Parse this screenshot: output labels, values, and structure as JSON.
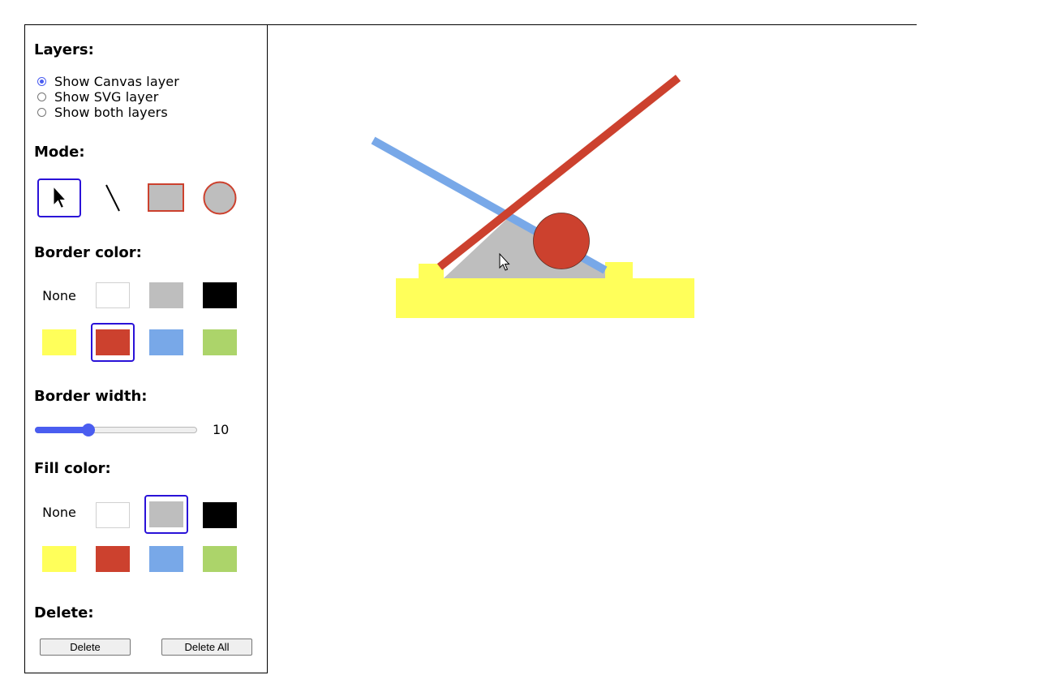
{
  "layers": {
    "heading": "Layers:",
    "options": [
      {
        "label": "Show Canvas layer",
        "checked": true
      },
      {
        "label": "Show SVG layer",
        "checked": false
      },
      {
        "label": "Show both layers",
        "checked": false
      }
    ]
  },
  "mode": {
    "heading": "Mode:",
    "tools": [
      {
        "name": "select-tool",
        "icon": "arrow-pointer-icon",
        "selected": true
      },
      {
        "name": "line-tool",
        "icon": "line-icon",
        "selected": false
      },
      {
        "name": "rectangle-tool",
        "icon": "rectangle-icon",
        "selected": false
      },
      {
        "name": "circle-tool",
        "icon": "circle-icon",
        "selected": false
      }
    ]
  },
  "border_color": {
    "heading": "Border color:",
    "none_label": "None",
    "swatches": [
      "#ffffff",
      "#bebebe",
      "#000000",
      "#ffff5a",
      "#cc412e",
      "#78a8e8",
      "#acd46a"
    ],
    "selected": "#cc412e"
  },
  "border_width": {
    "heading": "Border width:",
    "value": "10",
    "fraction": 0.33
  },
  "fill_color": {
    "heading": "Fill color:",
    "none_label": "None",
    "swatches": [
      "#ffffff",
      "#bebebe",
      "#000000",
      "#ffff5a",
      "#cc412e",
      "#78a8e8",
      "#acd46a"
    ],
    "selected": "#bebebe"
  },
  "delete": {
    "heading": "Delete:",
    "delete_label": "Delete",
    "delete_all_label": "Delete All"
  },
  "colors": {
    "accent": "#4a5df0",
    "selection_border": "#2a12d8",
    "yellow": "#ffff5a",
    "red": "#cc412e",
    "blue": "#78a8e8",
    "gray": "#bebebe"
  }
}
